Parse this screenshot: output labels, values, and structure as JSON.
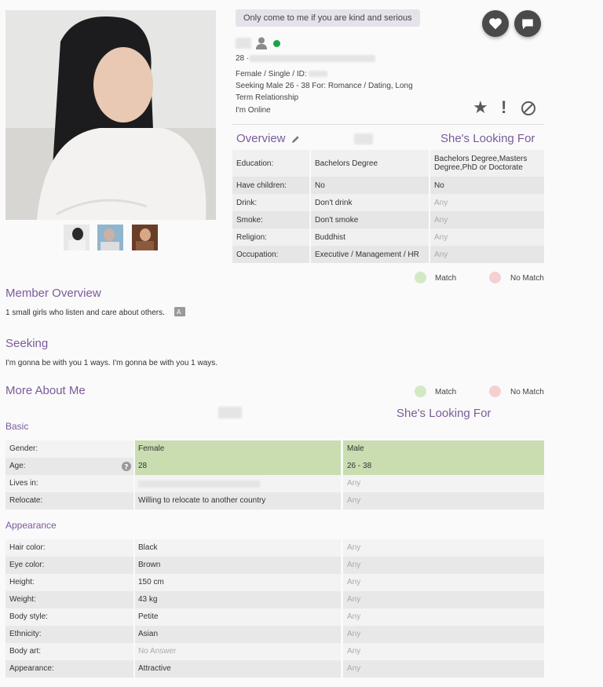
{
  "header": {
    "quote": "Only come to me if you are kind and serious",
    "age_prefix": "28 ·",
    "status_line": "Female / Single / ID:",
    "seeking_line1": "Seeking Male 26 - 38 For: Romance / Dating, Long",
    "seeking_line2": "Term Relationship",
    "online": "I'm Online",
    "colors": {
      "accent": "#7a5b9a",
      "online": "#1aa34a",
      "button": "#4a4a4a"
    }
  },
  "overview": {
    "title": "Overview",
    "looking_title": "She's Looking For",
    "rows": [
      {
        "label": "Education:",
        "value": "Bachelors Degree",
        "looking": "Bachelors Degree,Masters Degree,PhD or Doctorate"
      },
      {
        "label": "Have children:",
        "value": "No",
        "looking": "No"
      },
      {
        "label": "Drink:",
        "value": "Don't drink",
        "looking": "Any"
      },
      {
        "label": "Smoke:",
        "value": "Don't smoke",
        "looking": "Any"
      },
      {
        "label": "Religion:",
        "value": "Buddhist",
        "looking": "Any"
      },
      {
        "label": "Occupation:",
        "value": "Executive / Management / HR",
        "looking": "Any"
      }
    ]
  },
  "legend": {
    "match": "Match",
    "no_match": "No Match",
    "match_color": "#d5e8c4",
    "no_match_color": "#f5d0d0"
  },
  "member_overview": {
    "title": "Member Overview",
    "text": "1 small girls who listen and care about others."
  },
  "seeking": {
    "title": "Seeking",
    "text": "I'm gonna be with you 1 ways. I'm gonna be with you 1 ways."
  },
  "more_about": {
    "title": "More About Me",
    "looking_title": "She's Looking For",
    "basic_title": "Basic",
    "basic": [
      {
        "label": "Gender:",
        "value": "Female",
        "looking": "Male",
        "match": true
      },
      {
        "label": "Age:",
        "value": "28",
        "looking": "26 - 38",
        "match": true
      },
      {
        "label": "Lives in:",
        "value": "",
        "looking": "Any",
        "match": false
      },
      {
        "label": "Relocate:",
        "value": "Willing to relocate to another country",
        "looking": "Any",
        "match": false
      }
    ],
    "appearance_title": "Appearance",
    "appearance": [
      {
        "label": "Hair color:",
        "value": "Black",
        "looking": "Any"
      },
      {
        "label": "Eye color:",
        "value": "Brown",
        "looking": "Any"
      },
      {
        "label": "Height:",
        "value": "150 cm",
        "looking": "Any"
      },
      {
        "label": "Weight:",
        "value": "43 kg",
        "looking": "Any"
      },
      {
        "label": "Body style:",
        "value": "Petite",
        "looking": "Any"
      },
      {
        "label": "Ethnicity:",
        "value": "Asian",
        "looking": "Any"
      },
      {
        "label": "Body art:",
        "value": "No Answer",
        "looking": "Any"
      },
      {
        "label": "Appearance:",
        "value": "Attractive",
        "looking": "Any"
      }
    ]
  }
}
